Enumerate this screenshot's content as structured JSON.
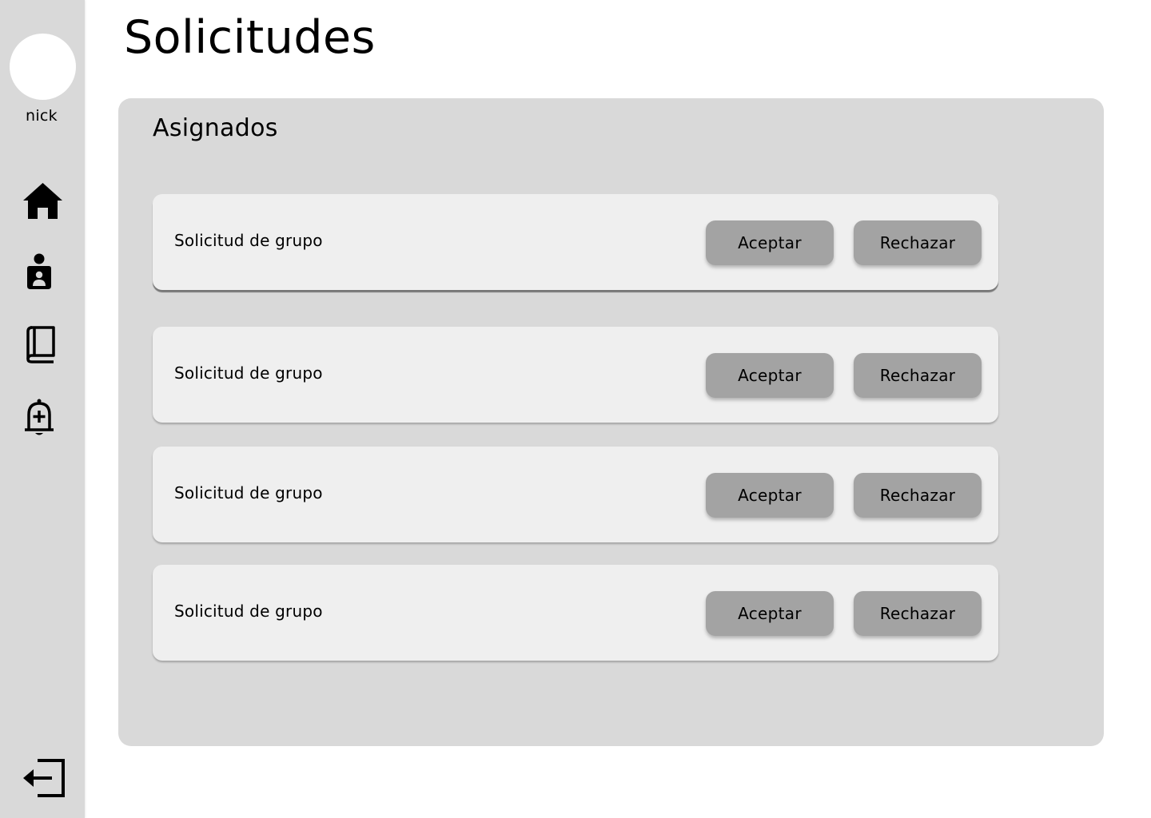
{
  "sidebar": {
    "username": "nick",
    "nav": [
      {
        "icon": "home-icon"
      },
      {
        "icon": "user-badge-icon"
      },
      {
        "icon": "book-icon"
      },
      {
        "icon": "bell-add-icon"
      }
    ],
    "logout_icon": "logout-icon"
  },
  "page": {
    "title": "Solicitudes"
  },
  "panel": {
    "title": "Asignados",
    "requests": [
      {
        "label": "Solicitud de grupo",
        "accept": "Aceptar",
        "reject": "Rechazar"
      },
      {
        "label": "Solicitud de grupo",
        "accept": "Aceptar",
        "reject": "Rechazar"
      },
      {
        "label": "Solicitud de grupo",
        "accept": "Aceptar",
        "reject": "Rechazar"
      },
      {
        "label": "Solicitud de grupo",
        "accept": "Aceptar",
        "reject": "Rechazar"
      }
    ]
  },
  "colors": {
    "sidebar_bg": "#d9d9d9",
    "panel_bg": "#d9d9d9",
    "card_bg": "#efefef",
    "button_bg": "#a3a3a3"
  }
}
